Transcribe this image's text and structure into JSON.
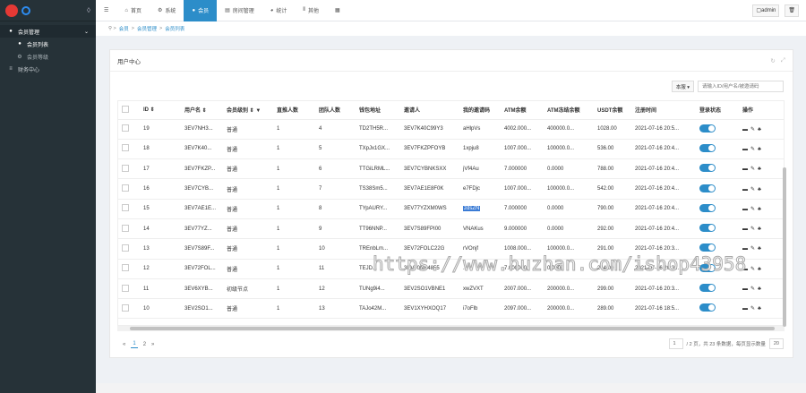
{
  "sidebar": {
    "menu_icon": "menu-icon",
    "items": [
      {
        "label": "会员管理",
        "icon": "user-icon"
      },
      {
        "label": "会员列表"
      },
      {
        "label": "会员等级"
      },
      {
        "label": "财务中心",
        "icon": "list-icon"
      }
    ]
  },
  "topbar": {
    "tabs": [
      {
        "label": "首页",
        "icon": "home-icon"
      },
      {
        "label": "系统",
        "icon": "gear-icon"
      },
      {
        "label": "会员",
        "icon": "user-icon"
      },
      {
        "label": "房间管理",
        "icon": "doc-icon"
      },
      {
        "label": "统计",
        "icon": "chart-icon"
      },
      {
        "label": "其他",
        "icon": "bars-icon"
      },
      {
        "label": "",
        "icon": "grid-icon"
      }
    ],
    "admin": "admin",
    "trash": "🗑"
  },
  "breadcrumb": [
    "会员",
    "会员管理",
    "会员列表"
  ],
  "panel": {
    "title": "用户中心",
    "select": "本服 ▾",
    "search_placeholder": "请输入ID/用户名/被邀请码"
  },
  "table": {
    "headers": [
      "",
      "ID ⇕",
      "用户名 ⇕",
      "会员级别 ⇕ ▼",
      "直推人数",
      "团队人数",
      "钱包地址",
      "邀请人",
      "我的邀请码",
      "ATM余额",
      "ATM冻结余额",
      "USDT余额",
      "注册时间",
      "登录状态",
      "操作"
    ],
    "rows": [
      [
        "19",
        "3EV7NH3...",
        "普通",
        "1",
        "4",
        "TD2TH5R...",
        "3EV7K40C99Y3",
        "aHlpVs",
        "4002.000...",
        "400000.0...",
        "1028.00",
        "2021-07-16 20:5..."
      ],
      [
        "18",
        "3EV7K40...",
        "普通",
        "1",
        "5",
        "TXpJx1GX...",
        "3EV7FKZPFOYB",
        "1xpju8",
        "1007.000...",
        "100000.0...",
        "536.00",
        "2021-07-16 20:4..."
      ],
      [
        "17",
        "3EV7FKZP...",
        "普通",
        "1",
        "6",
        "TTGiLRML...",
        "3EV7CYBNKSXX",
        "jVf4Au",
        "7.000000",
        "0.0000",
        "788.00",
        "2021-07-16 20:4..."
      ],
      [
        "16",
        "3EV7CYB...",
        "普通",
        "1",
        "7",
        "TS38Sm5...",
        "3EV7AE1E8F0K",
        "e7FDjc",
        "1007.000...",
        "100000.0...",
        "542.00",
        "2021-07-16 20:4..."
      ],
      [
        "15",
        "3EV7AE1E...",
        "普通",
        "1",
        "8",
        "TYpAURY...",
        "3EV77YZXM0WS",
        "zdsZN",
        "7.000000",
        "0.0000",
        "790.00",
        "2021-07-16 20:4..."
      ],
      [
        "14",
        "3EV77YZ...",
        "普通",
        "1",
        "9",
        "TT96NNP...",
        "3EV7S89FPI00",
        "VNAKus",
        "9.000000",
        "0.0000",
        "292.00",
        "2021-07-16 20:4..."
      ],
      [
        "13",
        "3EV7S89F...",
        "普通",
        "1",
        "10",
        "TREnbLm...",
        "3EV72FOLC22G",
        "rVOnjf",
        "1008.000...",
        "100000.0...",
        "291.00",
        "2021-07-16 20:3..."
      ],
      [
        "12",
        "3EV72FOL...",
        "普通",
        "1",
        "11",
        "TEJD...",
        "3EV70NK4855",
        "...",
        "7.000000",
        "0.0000",
        "244.00",
        "2021-07-16 20:3..."
      ],
      [
        "11",
        "3EV6XYB...",
        "初级节点",
        "1",
        "12",
        "TUNg9i4...",
        "3EV2SO1VBNE1",
        "xwZVXT",
        "2007.000...",
        "200000.0...",
        "299.00",
        "2021-07-16 20:3..."
      ],
      [
        "10",
        "3EV2SO1...",
        "普通",
        "1",
        "13",
        "TAJo42M...",
        "3EV1XYHXOQ17",
        "i7oFlb",
        "2097.000...",
        "200000.0...",
        "289.00",
        "2021-07-16 18:5..."
      ]
    ]
  },
  "pager": {
    "prev": "«",
    "pages": [
      "1",
      "2"
    ],
    "next": "»",
    "current_page": "1",
    "info": "/ 2 页，共 23 条数据，每页显示数量",
    "per_page": "20"
  },
  "watermark": "https://www.huzhan.com/ishop43958"
}
